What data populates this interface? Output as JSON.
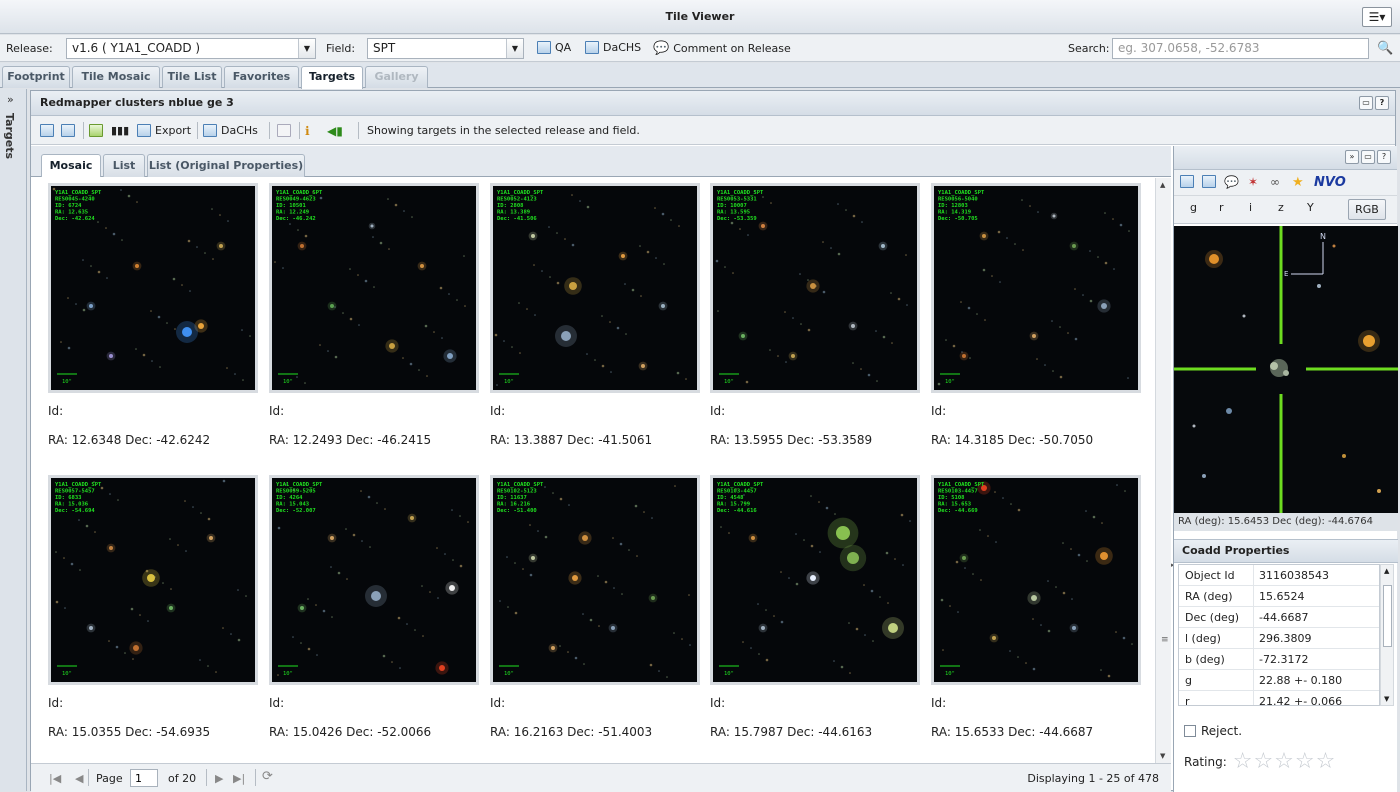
{
  "window": {
    "title": "Tile Viewer",
    "menu_icon": "☰▾"
  },
  "toolbar": {
    "release_label": "Release:",
    "release_value": "v1.6 ( Y1A1_COADD )",
    "field_label": "Field:",
    "field_value": "SPT",
    "qa_label": "QA",
    "dachs_label": "DaCHS",
    "comment_label": "Comment on Release",
    "search_label": "Search:",
    "search_placeholder": "eg. 307.0658, -52.6783"
  },
  "main_tabs": [
    "Footprint",
    "Tile Mosaic",
    "Tile List",
    "Favorites",
    "Targets",
    "Gallery"
  ],
  "side_collapsed": {
    "expand": "»",
    "label": "Targets"
  },
  "panel": {
    "title": "Redmapper clusters nblue ge 3",
    "export_label": "Export",
    "dachs_label": "DaCHs",
    "status_text": "Showing targets in the selected release and field."
  },
  "view_tabs": [
    "Mosaic",
    "List",
    "List (Original Properties)"
  ],
  "targets": [
    {
      "id_label": "Id:",
      "radec": "RA: 12.6348 Dec: -42.6242",
      "overlay": [
        "Y1A1_COADD_SPT",
        "RES0045-4240",
        "ID: 6724",
        "RA: 12.635",
        "Dec: -42.624"
      ]
    },
    {
      "id_label": "Id:",
      "radec": "RA: 12.2493 Dec: -46.2415",
      "overlay": [
        "Y1A1_COADD_SPT",
        "RES0049-4623",
        "ID: 10501",
        "RA: 12.249",
        "Dec: -46.242"
      ]
    },
    {
      "id_label": "Id:",
      "radec": "RA: 13.3887 Dec: -41.5061",
      "overlay": [
        "Y1A1_COADD_SPT",
        "RES0052-4123",
        "ID: 2808",
        "RA: 13.389",
        "Dec: -41.506"
      ]
    },
    {
      "id_label": "Id:",
      "radec": "RA: 13.5955 Dec: -53.3589",
      "overlay": [
        "Y1A1_COADD_SPT",
        "RES0053-5331",
        "ID: 10007",
        "RA: 13.595",
        "Dec: -53.359"
      ]
    },
    {
      "id_label": "Id:",
      "radec": "RA: 14.3185 Dec: -50.7050",
      "overlay": [
        "Y1A1_COADD_SPT",
        "RES0056-5040",
        "ID: 12803",
        "RA: 14.319",
        "Dec: -50.705"
      ]
    },
    {
      "id_label": "Id:",
      "radec": "RA: 15.0355 Dec: -54.6935",
      "overlay": [
        "Y1A1_COADD_SPT",
        "RES0057-5457",
        "ID: 6833",
        "RA: 15.036",
        "Dec: -54.694"
      ]
    },
    {
      "id_label": "Id:",
      "radec": "RA: 15.0426 Dec: -52.0066",
      "overlay": [
        "Y1A1_COADD_SPT",
        "RES0059-5205",
        "ID: 4264",
        "RA: 15.043",
        "Dec: -52.007"
      ]
    },
    {
      "id_label": "Id:",
      "radec": "RA: 16.2163 Dec: -51.4003",
      "overlay": [
        "Y1A1_COADD_SPT",
        "RES0102-5123",
        "ID: 11637",
        "RA: 16.216",
        "Dec: -51.400"
      ]
    },
    {
      "id_label": "Id:",
      "radec": "RA: 15.7987 Dec: -44.6163",
      "overlay": [
        "Y1A1_COADD_SPT",
        "RES0103-4457",
        "ID: 4548",
        "RA: 15.799",
        "Dec: -44.616"
      ]
    },
    {
      "id_label": "Id:",
      "radec": "RA: 15.6533 Dec: -44.6687",
      "overlay": [
        "Y1A1_COADD_SPT",
        "RES0103-4457",
        "ID: 5108",
        "RA: 15.653",
        "Dec: -44.669"
      ]
    }
  ],
  "scale_label": "10\"",
  "pager": {
    "page_label": "Page",
    "page_value": "1",
    "of_label": "of 20",
    "display_text": "Displaying 1 - 25 of 478"
  },
  "right_panel": {
    "bands": [
      "g",
      "r",
      "i",
      "z",
      "Y"
    ],
    "rgb_label": "RGB",
    "compass_n": "N",
    "compass_e": "E",
    "coords_text": "RA (deg): 15.6453 Dec (deg): -44.6764",
    "props_title": "Coadd Properties",
    "properties": [
      {
        "key": "Object Id",
        "value": "3116038543"
      },
      {
        "key": "RA (deg)",
        "value": "15.6524"
      },
      {
        "key": "Dec (deg)",
        "value": "-44.6687"
      },
      {
        "key": "l (deg)",
        "value": "296.3809"
      },
      {
        "key": "b (deg)",
        "value": "-72.3172"
      },
      {
        "key": "g",
        "value": "22.88 +- 0.180"
      },
      {
        "key": "r",
        "value": "21.42 +- 0.066"
      }
    ],
    "reject_label": "Reject.",
    "rating_label": "Rating:",
    "stars": "☆☆☆☆☆",
    "nvo_label": "NVO"
  },
  "colors": {
    "overlay_text": "#20e020",
    "crosshair": "#6ddc20",
    "panel_border": "#99a6b4"
  }
}
